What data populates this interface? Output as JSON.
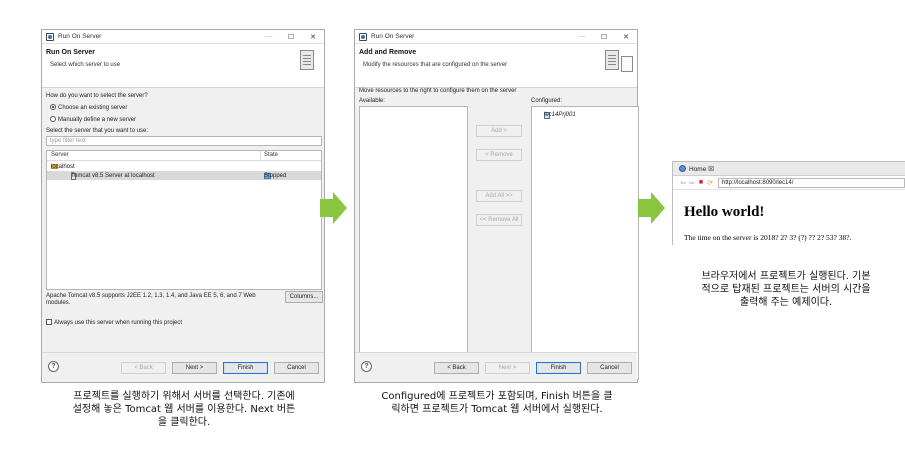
{
  "dialog1": {
    "title": "Run On Server",
    "heading": "Run On Server",
    "subheading": "Select which server to use",
    "question": "How do you want to select the server?",
    "radio_existing": "Choose an existing server",
    "radio_manual": "Manually define a new server",
    "select_label": "Select the server that you want to use:",
    "filter_placeholder": "type filter text",
    "col_server": "Server",
    "col_state": "State",
    "host": "localhost",
    "server_name": "Tomcat v8.5 Server at localhost",
    "server_state": "Stopped",
    "description": "Apache Tomcat v8.5 supports J2EE 1.2, 1.3, 1.4, and Java EE 5, 6, and 7 Web modules.",
    "columns_btn": "Columns...",
    "always_use": "Always use this server when running this project",
    "back_btn": "< Back",
    "next_btn": "Next >",
    "finish_btn": "Finish",
    "cancel_btn": "Cancel",
    "help": "?"
  },
  "dialog2": {
    "title": "Run On Server",
    "heading": "Add and Remove",
    "subheading": "Modify the resources that are configured on the server",
    "instruction": "Move resources to the right to configure them on the server",
    "available_label": "Available:",
    "configured_label": "Configured:",
    "configured_item": "lec14Prj001",
    "add_btn": "Add >",
    "remove_btn": "< Remove",
    "add_all_btn": "Add All >>",
    "remove_all_btn": "<< Remove All",
    "back_btn": "< Back",
    "next_btn": "Next >",
    "finish_btn": "Finish",
    "cancel_btn": "Cancel",
    "help": "?"
  },
  "browser": {
    "tab_label": "Home ☒",
    "url": "http://localhost:8090/lec14/",
    "heading": "Hello world!",
    "body_text": "The time on the server is 2018? 2? 3? (?) ?? 2? 53? 38?."
  },
  "captions": {
    "caption1_l1": "프로젝트를 실행하기 위해서 서버를 선택한다. 기존에",
    "caption1_l2": "설정해 놓은 Tomcat 웹 서버를 이용한다. Next 버튼",
    "caption1_l3": "을 클릭한다.",
    "caption2_l1": "Configured에 프로젝트가 포함되며, Finish 버튼을 클",
    "caption2_l2": "릭하면 프로젝트가 Tomcat 웹 서버에서 실행된다.",
    "caption3_l1": "브라우저에서 프로젝트가 실행된다. 기본",
    "caption3_l2": "적으로 탑재된 프로젝트는 서버의 시간을",
    "caption3_l3": "출력해 주는 예제이다."
  },
  "colors": {
    "arrow": "#8bc53f",
    "finish_border": "#2f73c9"
  }
}
